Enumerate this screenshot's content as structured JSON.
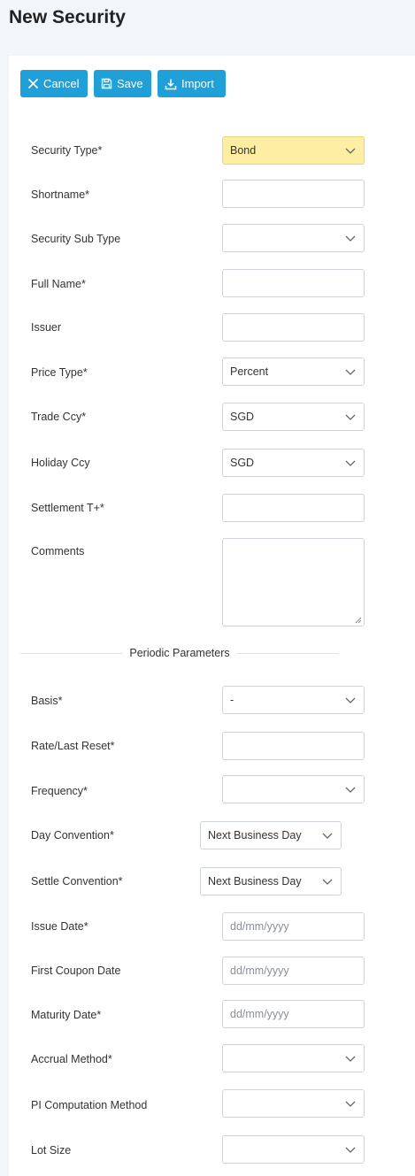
{
  "page": {
    "title": "New Security"
  },
  "toolbar": {
    "cancel_label": "Cancel",
    "save_label": "Save",
    "import_label": "Import",
    "button_color": "#1fa0d8"
  },
  "form": {
    "security_type": {
      "label": "Security Type*",
      "value": "Bond",
      "highlight": "#fdeea4"
    },
    "shortname": {
      "label": "Shortname*",
      "value": ""
    },
    "security_sub_type": {
      "label": "Security Sub Type",
      "value": ""
    },
    "full_name": {
      "label": "Full Name*",
      "value": ""
    },
    "issuer": {
      "label": "Issuer",
      "value": ""
    },
    "price_type": {
      "label": "Price Type*",
      "value": "Percent"
    },
    "trade_ccy": {
      "label": "Trade Ccy*",
      "value": "SGD"
    },
    "holiday_ccy": {
      "label": "Holiday Ccy",
      "value": "SGD"
    },
    "settlement": {
      "label": "Settlement T+*",
      "value": ""
    },
    "comments": {
      "label": "Comments",
      "value": ""
    }
  },
  "periodic": {
    "section_title": "Periodic Parameters",
    "basis": {
      "label": "Basis*",
      "value": "-"
    },
    "rate_last_reset": {
      "label": "Rate/Last Reset*",
      "value": ""
    },
    "frequency": {
      "label": "Frequency*",
      "value": ""
    },
    "day_convention": {
      "label": "Day Convention*",
      "value": "Next Business Day"
    },
    "settle_convention": {
      "label": "Settle Convention*",
      "value": "Next Business Day"
    },
    "issue_date": {
      "label": "Issue Date*",
      "placeholder": "dd/mm/yyyy"
    },
    "first_coupon_date": {
      "label": "First Coupon Date",
      "placeholder": "dd/mm/yyyy"
    },
    "maturity_date": {
      "label": "Maturity Date*",
      "placeholder": "dd/mm/yyyy"
    },
    "accrual_method": {
      "label": "Accrual Method*",
      "value": ""
    },
    "pi_computation_method": {
      "label": "PI Computation Method",
      "value": ""
    },
    "lot_size": {
      "label": "Lot Size",
      "value": ""
    }
  }
}
